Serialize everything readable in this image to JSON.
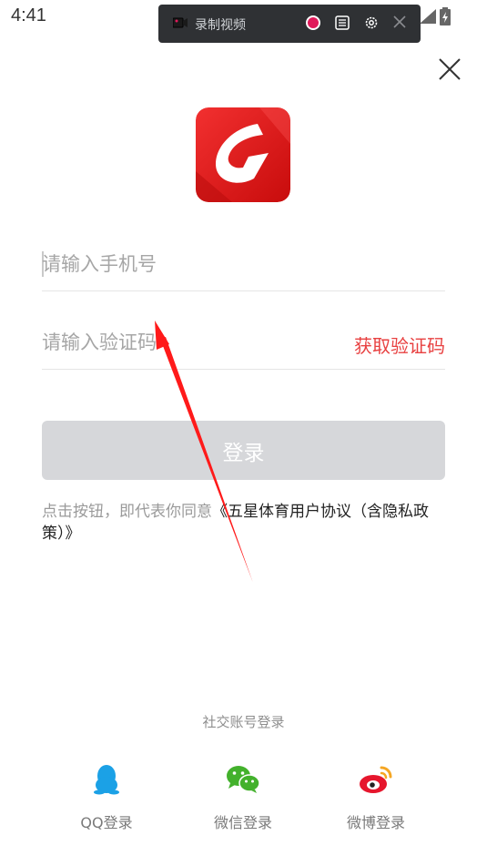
{
  "status_bar": {
    "time": "4:41"
  },
  "recorder": {
    "label": "录制视频"
  },
  "login": {
    "phone_placeholder": "请输入手机号",
    "code_placeholder": "请输入验证码",
    "get_code": "获取验证码",
    "login_button": "登录",
    "agreement_prefix": "点击按钮，即代表你同意",
    "agreement_link": "《五星体育用户协议（含隐私政策）》"
  },
  "social": {
    "title": "社交账号登录",
    "qq": "QQ登录",
    "wechat": "微信登录",
    "weibo": "微博登录"
  },
  "colors": {
    "accent_red": "#e84141",
    "button_gray": "#d6d7da",
    "logo_red": "#e31b1b"
  },
  "icons": [
    "camera-icon",
    "record-icon",
    "list-icon",
    "gear-icon",
    "close-icon",
    "wifi-icon",
    "signal-icon",
    "battery-icon",
    "qq-icon",
    "wechat-icon",
    "weibo-icon",
    "app-logo"
  ]
}
